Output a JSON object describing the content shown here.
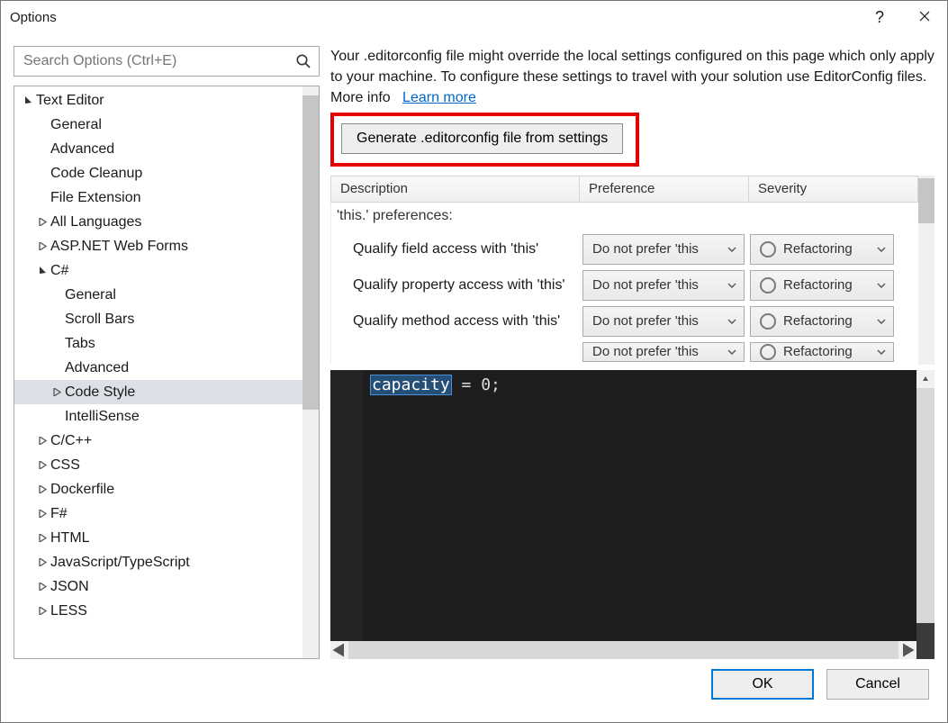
{
  "window": {
    "title": "Options"
  },
  "search": {
    "placeholder": "Search Options (Ctrl+E)"
  },
  "tree": {
    "root": "Text Editor",
    "items": [
      {
        "label": "General",
        "depth": 2,
        "exp": "none"
      },
      {
        "label": "Advanced",
        "depth": 2,
        "exp": "none"
      },
      {
        "label": "Code Cleanup",
        "depth": 2,
        "exp": "none"
      },
      {
        "label": "File Extension",
        "depth": 2,
        "exp": "none"
      },
      {
        "label": "All Languages",
        "depth": 2,
        "exp": "closed"
      },
      {
        "label": "ASP.NET Web Forms",
        "depth": 2,
        "exp": "closed"
      },
      {
        "label": "C#",
        "depth": 2,
        "exp": "open"
      },
      {
        "label": "General",
        "depth": 3,
        "exp": "none"
      },
      {
        "label": "Scroll Bars",
        "depth": 3,
        "exp": "none"
      },
      {
        "label": "Tabs",
        "depth": 3,
        "exp": "none"
      },
      {
        "label": "Advanced",
        "depth": 3,
        "exp": "none"
      },
      {
        "label": "Code Style",
        "depth": 3,
        "exp": "closed",
        "selected": true
      },
      {
        "label": "IntelliSense",
        "depth": 3,
        "exp": "none"
      },
      {
        "label": "C/C++",
        "depth": 2,
        "exp": "closed"
      },
      {
        "label": "CSS",
        "depth": 2,
        "exp": "closed"
      },
      {
        "label": "Dockerfile",
        "depth": 2,
        "exp": "closed"
      },
      {
        "label": "F#",
        "depth": 2,
        "exp": "closed"
      },
      {
        "label": "HTML",
        "depth": 2,
        "exp": "closed"
      },
      {
        "label": "JavaScript/TypeScript",
        "depth": 2,
        "exp": "closed"
      },
      {
        "label": "JSON",
        "depth": 2,
        "exp": "closed"
      },
      {
        "label": "LESS",
        "depth": 2,
        "exp": "closed"
      }
    ]
  },
  "info": {
    "text": "Your .editorconfig file might override the local settings configured on this page which only apply to your machine. To configure these settings to travel with your solution use EditorConfig files. More info",
    "link": "Learn more"
  },
  "generate": {
    "label": "Generate .editorconfig file from settings"
  },
  "grid": {
    "headers": {
      "desc": "Description",
      "pref": "Preference",
      "sev": "Severity"
    },
    "section": "'this.' preferences:",
    "rows": [
      {
        "desc": "Qualify field access with 'this'",
        "pref": "Do not prefer 'this",
        "sev": "Refactoring"
      },
      {
        "desc": "Qualify property access with 'this'",
        "pref": "Do not prefer 'this",
        "sev": "Refactoring"
      },
      {
        "desc": "Qualify method access with 'this'",
        "pref": "Do not prefer 'this",
        "sev": "Refactoring"
      },
      {
        "desc": "",
        "pref": "Do not prefer 'this",
        "sev": "Refactoring"
      }
    ]
  },
  "editor": {
    "highlight": "capacity",
    "rest": " = 0;"
  },
  "footer": {
    "ok": "OK",
    "cancel": "Cancel"
  }
}
